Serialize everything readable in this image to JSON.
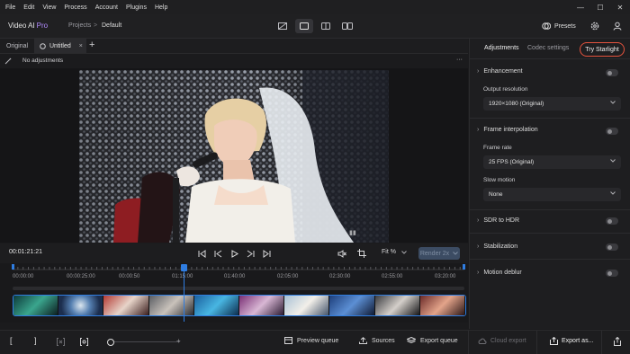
{
  "menu": [
    "File",
    "Edit",
    "View",
    "Process",
    "Account",
    "Plugins",
    "Help"
  ],
  "window_controls": {
    "minimize": "—",
    "maximize": "☐",
    "close": "✕"
  },
  "app": {
    "name": "Video AI",
    "edition": "Pro"
  },
  "breadcrumb": {
    "projects": "Projects",
    "separator": ">",
    "current": "Default"
  },
  "header": {
    "presets_label": "Presets"
  },
  "tabs": {
    "original": "Original",
    "untitled": "Untitled",
    "close": "×",
    "add": "+"
  },
  "adjustments_bar": {
    "status": "No adjustments",
    "more": "···"
  },
  "transport": {
    "timecode": "00:01:21:21",
    "zoom": "Fit %",
    "render_label": "Render 2x"
  },
  "timeline": {
    "ticks": [
      "00:00:00",
      "00:00:25:00",
      "00:00:50",
      "01:15:00",
      "01:40:00",
      "02:05:00",
      "02:30:00",
      "02:55:00",
      "03:20:00"
    ]
  },
  "bottom": {
    "bracket_in": "[",
    "bracket_out": "]",
    "preview_queue": "Preview queue",
    "sources": "Sources",
    "export_queue": "Export queue",
    "cloud_export": "Cloud export",
    "export_as": "Export as..."
  },
  "panel": {
    "tab_adjustments": "Adjustments",
    "tab_codec": "Codec settings",
    "try_label": "Try Starlight",
    "enhancement": "Enhancement",
    "output_resolution_label": "Output resolution",
    "output_resolution_value": "1920×1080 (Original)",
    "frame_interpolation": "Frame interpolation",
    "frame_rate_label": "Frame rate",
    "frame_rate_value": "25 FPS (Original)",
    "slow_motion_label": "Slow motion",
    "slow_motion_value": "None",
    "sdr_to_hdr": "SDR to HDR",
    "stabilization": "Stabilization",
    "motion_deblur": "Motion deblur"
  },
  "colors": {
    "accent_blue": "#2f7de1",
    "try_border": "#e5533e",
    "pro_purple": "#b38cff"
  }
}
